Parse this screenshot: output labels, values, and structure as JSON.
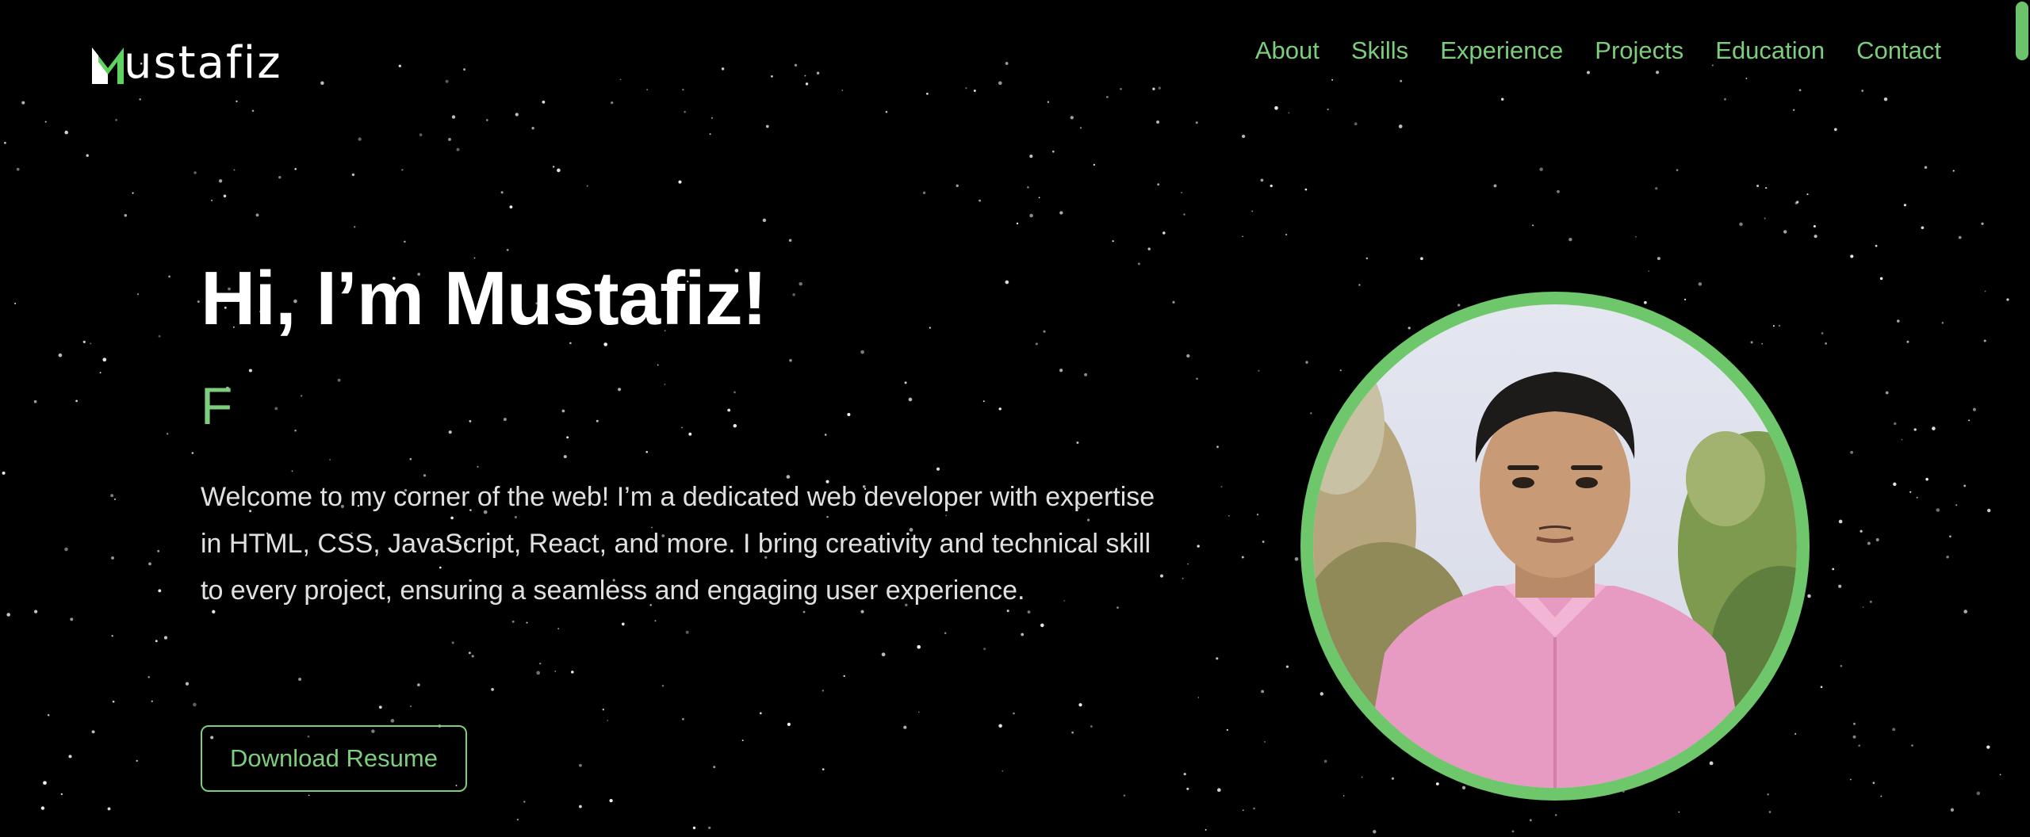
{
  "header": {
    "logo_initial": "M",
    "logo_rest": "ustafiz"
  },
  "nav": {
    "items": [
      {
        "label": "About"
      },
      {
        "label": "Skills"
      },
      {
        "label": "Experience"
      },
      {
        "label": "Projects"
      },
      {
        "label": "Education"
      },
      {
        "label": "Contact"
      }
    ]
  },
  "hero": {
    "title": "Hi, I’m Mustafiz!",
    "typed_text": "F",
    "intro": "Welcome to my corner of the web! I’m a dedicated web developer with expertise in HTML, CSS, JavaScript, React, and more. I bring creativity and technical skill to every project, ensuring a seamless and engaging user experience.",
    "resume_button": "Download Resume"
  },
  "colors": {
    "accent": "#7ccd7c",
    "background": "#000000",
    "text": "#ffffff"
  },
  "icons": {
    "photo": "profile-photo"
  }
}
